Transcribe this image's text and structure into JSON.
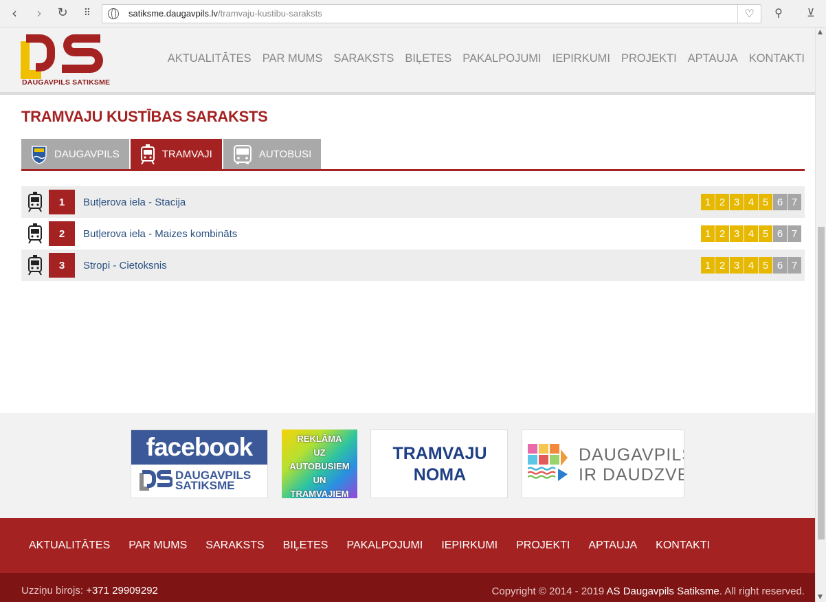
{
  "browser": {
    "url_host": "satiksme.daugavpils.lv",
    "url_path": "/tramvaju-kustibu-saraksts",
    "icons": [
      "back-icon",
      "forward-icon",
      "reload-icon",
      "apps-grid-icon",
      "globe-icon",
      "heart-icon",
      "extension-icon",
      "download-icon"
    ]
  },
  "header": {
    "logo_text": "DAUGAVPILS SATIKSME",
    "nav": [
      "AKTUALITĀTES",
      "PAR MUMS",
      "SARAKSTS",
      "BIĻETES",
      "PAKALPOJUMI",
      "IEPIRKUMI",
      "PROJEKTI",
      "APTAUJA",
      "KONTAKTI"
    ]
  },
  "main": {
    "title": "TRAMVAJU KUSTĪBAS SARAKSTS",
    "tabs": [
      {
        "label": "DAUGAVPILS",
        "active": false
      },
      {
        "label": "TRAMVAJI",
        "active": true
      },
      {
        "label": "AUTOBUSI",
        "active": false
      }
    ],
    "routes": [
      {
        "number": "1",
        "name": "Butļerova iela - Stacija"
      },
      {
        "number": "2",
        "name": "Butļerova iela - Maizes kombināts"
      },
      {
        "number": "3",
        "name": "Stropi - Cietoksnis"
      }
    ],
    "days": [
      "1",
      "2",
      "3",
      "4",
      "5",
      "6",
      "7"
    ]
  },
  "banners": {
    "facebook_top": "facebook",
    "facebook_line1": "DAUGAVPILS",
    "facebook_line2": "SATIKSME",
    "reklama": [
      "REKLĀMA",
      "UZ",
      "AUTOBUSIEM",
      "UN",
      "TRAMVAJIEM"
    ],
    "noma_line1": "TRAMVAJU",
    "noma_line2": "NOMA",
    "daudz_line1": "DAUGAVPILS",
    "daudz_line2": "IR DAUDZVEIDĪBA"
  },
  "footer": {
    "nav": [
      "AKTUALITĀTES",
      "PAR MUMS",
      "SARAKSTS",
      "BIĻETES",
      "PAKALPOJUMI",
      "IEPIRKUMI",
      "PROJEKTI",
      "APTAUJA",
      "KONTAKTI"
    ],
    "info_label": "Uzziņu birojs:",
    "info_phone": "+371 29909292",
    "copyright_prefix": "Copyright © 2014 - 2019",
    "copyright_company": "AS Daugavpils Satiksme",
    "copyright_suffix": ". All right reserved."
  },
  "colors": {
    "brand_red": "#a52222",
    "brand_yellow": "#e6b800",
    "weekend_grey": "#a6a6a6",
    "link_blue": "#2a5080"
  }
}
